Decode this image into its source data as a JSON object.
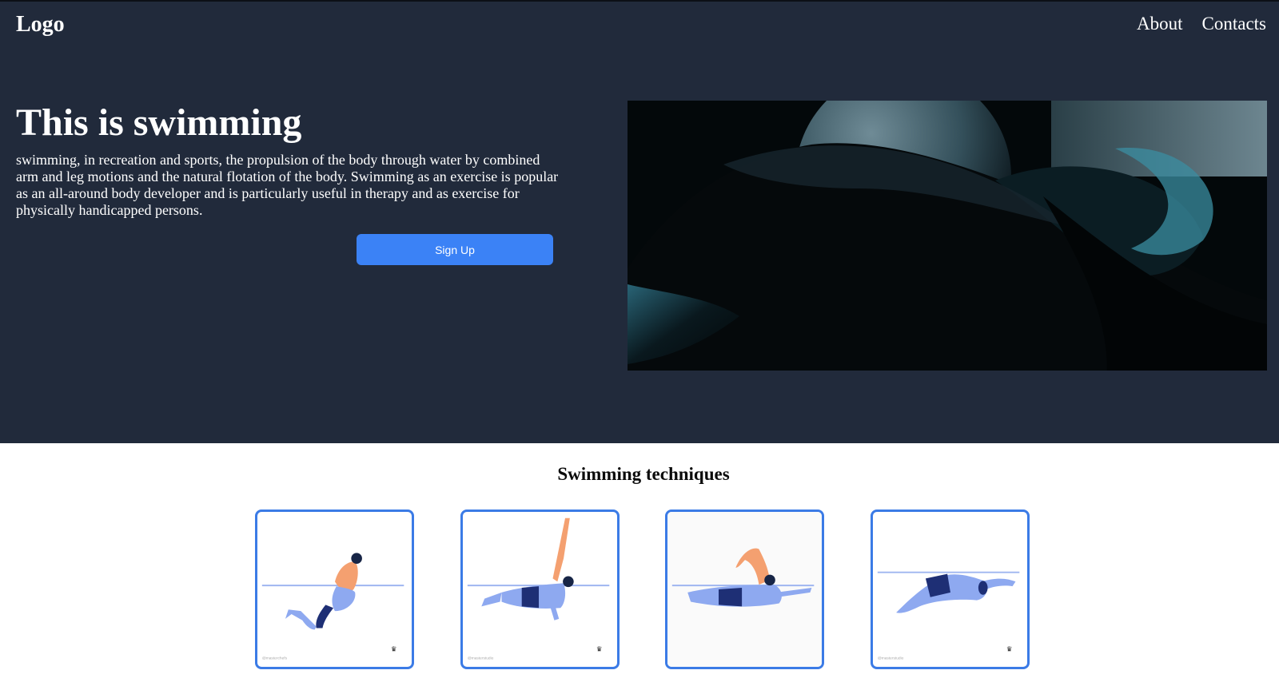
{
  "header": {
    "logo": "Logo",
    "nav": [
      "About",
      "Contacts"
    ]
  },
  "hero": {
    "title": "This is swimming",
    "description": "swimming, in recreation and sports, the propulsion of the body through water by combined arm and leg motions and the natural flotation of the body. Swimming as an exercise is popular as an all-around body developer and is particularly useful in therapy and as exercise for physically handicapped persons.",
    "cta_label": "Sign Up",
    "image": "abstract-dark-teal-3d-shapes"
  },
  "techniques": {
    "title": "Swimming techniques",
    "cards": [
      {
        "icon": "breaststroke-swimmer-illustration",
        "footer_text": "@masterchefs"
      },
      {
        "icon": "backstroke-swimmer-illustration",
        "footer_text": "@masterstudio"
      },
      {
        "icon": "freestyle-swimmer-illustration",
        "footer_text": ""
      },
      {
        "icon": "butterfly-swimmer-illustration",
        "footer_text": "@masterstudio"
      }
    ]
  },
  "colors": {
    "hero_background": "#212a3b",
    "accent": "#3b82f6",
    "card_border": "#3b7be6",
    "swimmer_skin": "#f4a070",
    "swimmer_body_water": "#8ea9f0",
    "swimwear": "#1e2f75"
  }
}
